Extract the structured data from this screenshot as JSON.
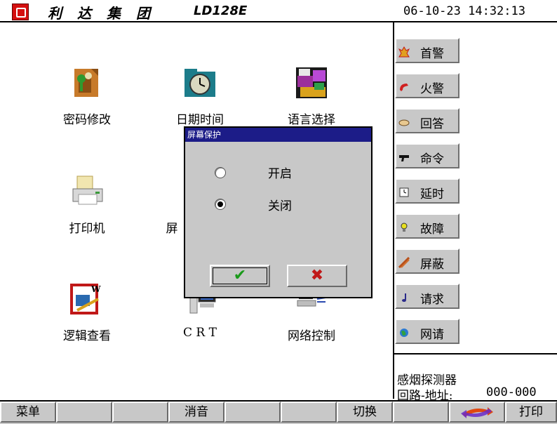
{
  "header": {
    "company": "利达集团",
    "model": "LD128E",
    "datetime": "06-10-23 14:32:13"
  },
  "main": {
    "tiles": [
      {
        "label": "密码修改",
        "icon": "password-icon"
      },
      {
        "label": "日期时间",
        "icon": "clock-icon"
      },
      {
        "label": "语言选择",
        "icon": "language-icon"
      },
      {
        "label": "打印机",
        "icon": "printer-icon"
      },
      {
        "label": "屏",
        "icon": "screen-icon"
      },
      {
        "label": "逻辑查看",
        "icon": "logic-icon"
      },
      {
        "label": "C R T",
        "icon": "crt-icon"
      },
      {
        "label": "网络控制",
        "icon": "network-icon"
      }
    ]
  },
  "right_panel": {
    "buttons": [
      {
        "label": "首警",
        "icon": "first-alarm-icon"
      },
      {
        "label": "火警",
        "icon": "fire-alarm-icon"
      },
      {
        "label": "回答",
        "icon": "answer-icon"
      },
      {
        "label": "命令",
        "icon": "command-icon"
      },
      {
        "label": "延时",
        "icon": "delay-icon"
      },
      {
        "label": "故障",
        "icon": "fault-icon"
      },
      {
        "label": "屏蔽",
        "icon": "shield-icon"
      },
      {
        "label": "请求",
        "icon": "request-icon"
      },
      {
        "label": "网请",
        "icon": "network-request-icon"
      }
    ],
    "info": {
      "device": "感烟探测器",
      "loop_label": "回路-地址:",
      "loop_value": "000-000"
    }
  },
  "bottom": {
    "buttons": [
      "菜单",
      "",
      "",
      "消音",
      "",
      "",
      "切换",
      "",
      "",
      "打印"
    ]
  },
  "dialog": {
    "title": "屏幕保护",
    "options": [
      {
        "label": "开启",
        "selected": false
      },
      {
        "label": "关闭",
        "selected": true
      }
    ],
    "ok_symbol": "✔",
    "cancel_symbol": "✖"
  },
  "colors": {
    "dialog_title_bg": "#1c1c88",
    "button_face": "#c8c8c8",
    "ok_green": "#1a9a1a",
    "cancel_red": "#c01818"
  }
}
